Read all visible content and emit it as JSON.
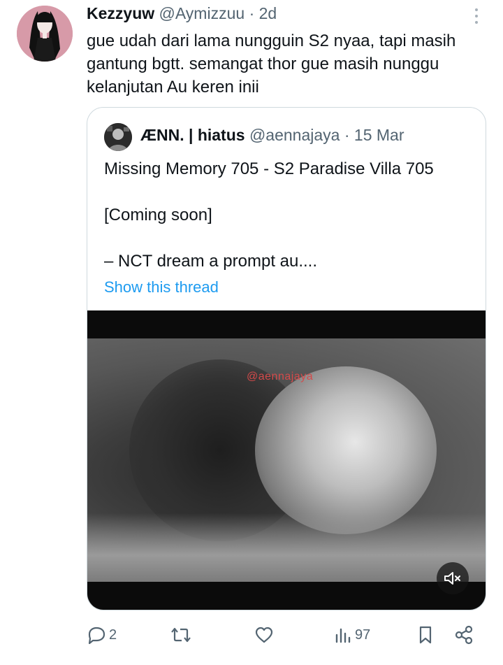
{
  "tweet": {
    "display_name": "Kezzyuw",
    "handle": "@Aymizzuu",
    "separator": "·",
    "time": "2d",
    "text": "gue udah dari lama nungguin S2 nyaa, tapi masih gantung bgtt. semangat thor gue masih nunggu kelanjutan Au keren inii",
    "avatar_icon": "user-avatar",
    "more_icon": "more-vertical-icon"
  },
  "quote": {
    "display_name": "ÆNN. | hiatus",
    "handle": "@aennajaya",
    "separator": "·",
    "time": "15 Mar",
    "lines": [
      "Missing Memory 705 - S2 Paradise Villa 705",
      "[Coming soon]",
      "– NCT dream a prompt au...."
    ],
    "show_thread": "Show this thread",
    "media": {
      "watermark": "@aennajaya",
      "mute_icon": "volume-muted-icon"
    }
  },
  "actions": {
    "reply": {
      "icon": "reply-icon",
      "count": "2"
    },
    "retweet": {
      "icon": "retweet-icon",
      "count": ""
    },
    "like": {
      "icon": "heart-icon",
      "count": ""
    },
    "views": {
      "icon": "views-icon",
      "count": "97"
    },
    "bookmark": {
      "icon": "bookmark-icon"
    },
    "share": {
      "icon": "share-icon"
    }
  },
  "colors": {
    "link": "#1d9bf0",
    "secondary_text": "#536471",
    "primary_text": "#0f1419",
    "border": "#cfd9de"
  }
}
